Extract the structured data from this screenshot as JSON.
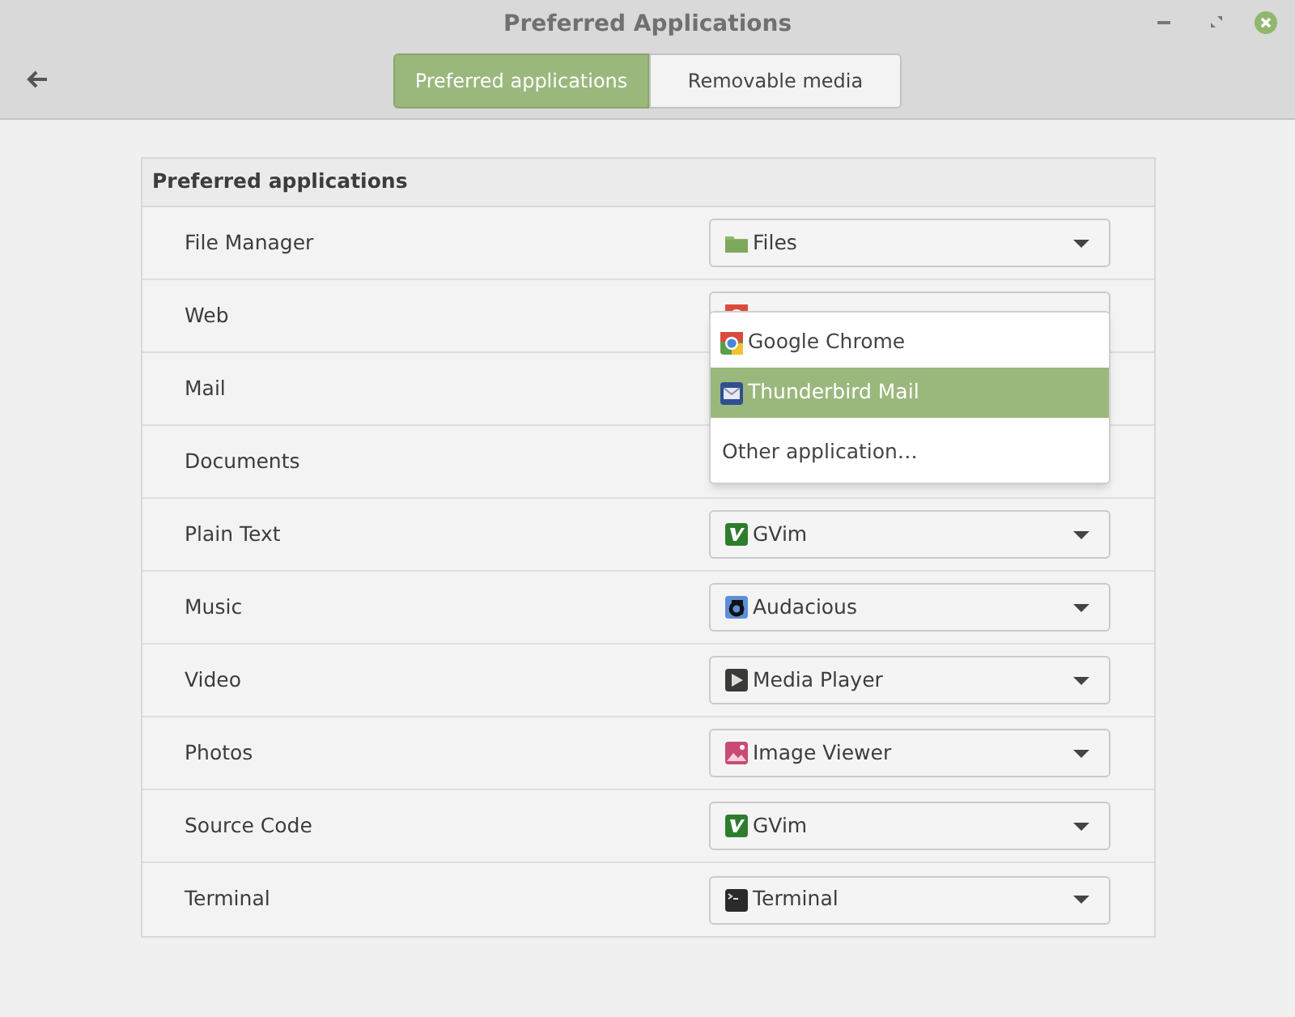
{
  "window": {
    "title": "Preferred Applications"
  },
  "tabs": [
    {
      "label": "Preferred applications",
      "selected": true
    },
    {
      "label": "Removable media",
      "selected": false
    }
  ],
  "panel": {
    "header": "Preferred applications",
    "rows": [
      {
        "label": "File Manager",
        "combo": {
          "kind": "folder",
          "value": "Files"
        }
      },
      {
        "label": "Web",
        "combo": {
          "kind": "chrome"
        }
      },
      {
        "label": "Mail"
      },
      {
        "label": "Documents"
      },
      {
        "label": "Plain Text",
        "combo": {
          "kind": "vim",
          "value": "GVim"
        }
      },
      {
        "label": "Music",
        "combo": {
          "kind": "audacious",
          "value": "Audacious"
        }
      },
      {
        "label": "Video",
        "combo": {
          "kind": "player",
          "value": "Media Player"
        }
      },
      {
        "label": "Photos",
        "combo": {
          "kind": "image",
          "value": "Image Viewer"
        }
      },
      {
        "label": "Source Code",
        "combo": {
          "kind": "vim",
          "value": "GVim"
        }
      },
      {
        "label": "Terminal",
        "combo": {
          "kind": "terminal",
          "value": "Terminal"
        }
      }
    ]
  },
  "popup": {
    "items": [
      {
        "kind": "chrome",
        "label": "Google Chrome",
        "selected": false
      },
      {
        "kind": "mail",
        "label": "Thunderbird Mail",
        "selected": true
      }
    ],
    "other": "Other application…"
  }
}
